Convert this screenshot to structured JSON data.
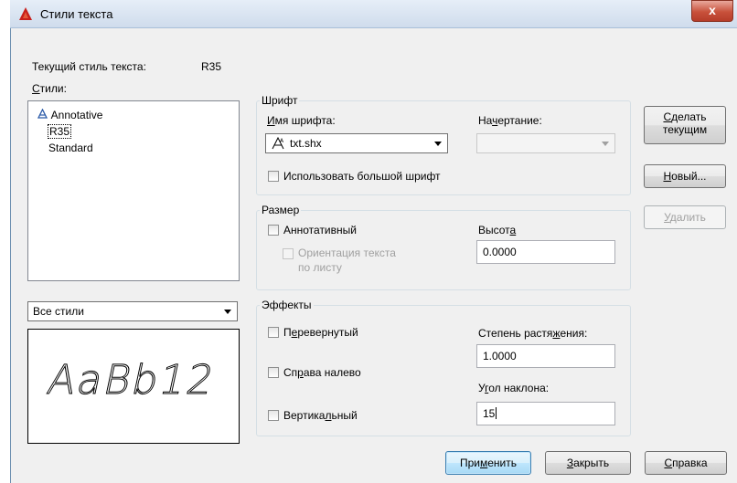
{
  "window": {
    "title": "Стили текста",
    "app_icon": "autocad-a-icon",
    "close_label": "x"
  },
  "current_style": {
    "label": "Текущий стиль текста:",
    "value": "R35"
  },
  "styles": {
    "label": "Стили:",
    "items": [
      {
        "label": "Annotative",
        "icon": "annotative-icon"
      },
      {
        "label": "R35",
        "selected": true
      },
      {
        "label": "Standard"
      }
    ],
    "filter_value": "Все стили"
  },
  "preview": {
    "text": "AaBb12"
  },
  "font": {
    "group_label": "Шрифт",
    "name_label": "Имя шрифта:",
    "name_value": "txt.shx",
    "style_label": "Начертание:",
    "style_value": "",
    "bigfont_label": "Использовать большой шрифт",
    "bigfont_checked": false
  },
  "size": {
    "group_label": "Размер",
    "annotative_label": "Аннотативный",
    "annotative_checked": false,
    "orientation_label_line1": "Ориентация текста",
    "orientation_label_line2": "по листу",
    "height_label": "Высота",
    "height_value": "0.0000"
  },
  "effects": {
    "group_label": "Эффекты",
    "upside_down_label": "Перевернутый",
    "backwards_label": "Справа налево",
    "vertical_label": "Вертикальный",
    "width_factor_label": "Степень растяжения:",
    "width_factor_value": "1.0000",
    "oblique_label": "Угол наклона:",
    "oblique_value": "15"
  },
  "side_buttons": {
    "set_current_line1": "Сделать",
    "set_current_line2": "текущим",
    "new_label": "Новый...",
    "delete_label": "Удалить"
  },
  "bottom_buttons": {
    "apply_label": "Применить",
    "close_label": "Закрыть",
    "help_label": "Справка"
  },
  "colors": {
    "accent": "#3c7fb1",
    "close_button": "#c8513b",
    "window_bg": "#f0f0f0"
  }
}
